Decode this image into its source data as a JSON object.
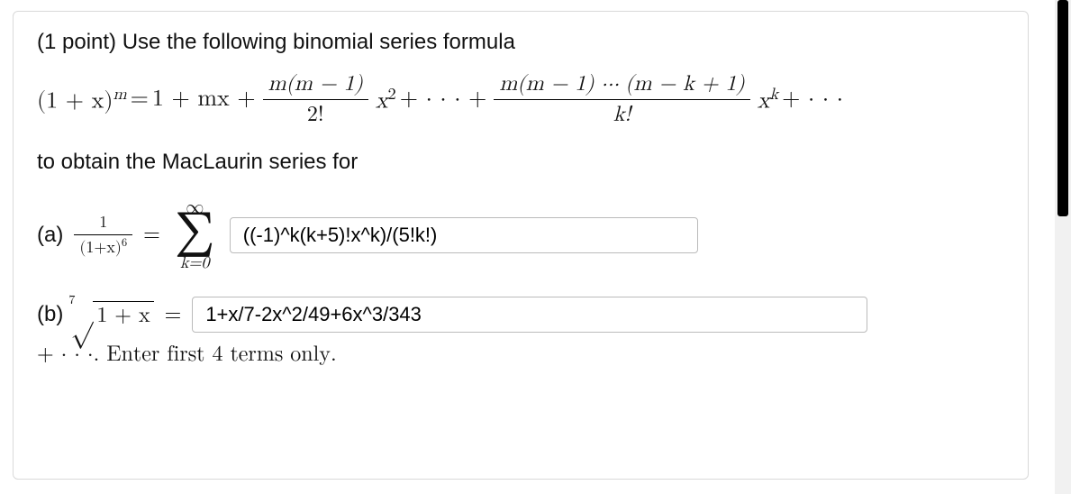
{
  "problem": {
    "points_label": "(1 point)",
    "intro_text": "Use the following binomial series formula",
    "lead_out_text": "to obtain the MacLaurin series for"
  },
  "formula": {
    "lhs_base": "(1 + x)",
    "lhs_exp": "m",
    "eq": "=",
    "t1": "1 + mx +",
    "f1_num": "m(m − 1)",
    "f1_den": "2!",
    "after_f1": "x",
    "after_f1_exp": "2",
    "plus_dots_plus": " + · · · + ",
    "f2_num": "m(m − 1) ⋯ (m − k + 1)",
    "f2_den": "k!",
    "after_f2": "x",
    "after_f2_exp": "k",
    "tail": " + · · ·"
  },
  "part_a": {
    "label": "(a)",
    "frac_num": "1",
    "frac_den_left": "(1+x)",
    "frac_den_exp": "6",
    "eq": "=",
    "sigma_top": "∞",
    "sigma_sym": "∑",
    "sigma_bottom": "k=0",
    "answer": "((-1)^k(k+5)!x^k)/(5!k!)"
  },
  "part_b": {
    "label": "(b)",
    "root_index": "7",
    "radicand": "1 + x",
    "eq": "=",
    "answer": "1+x/7-2x^2/49+6x^3/343",
    "tail": "+ · · ·. Enter first 4 terms only."
  }
}
